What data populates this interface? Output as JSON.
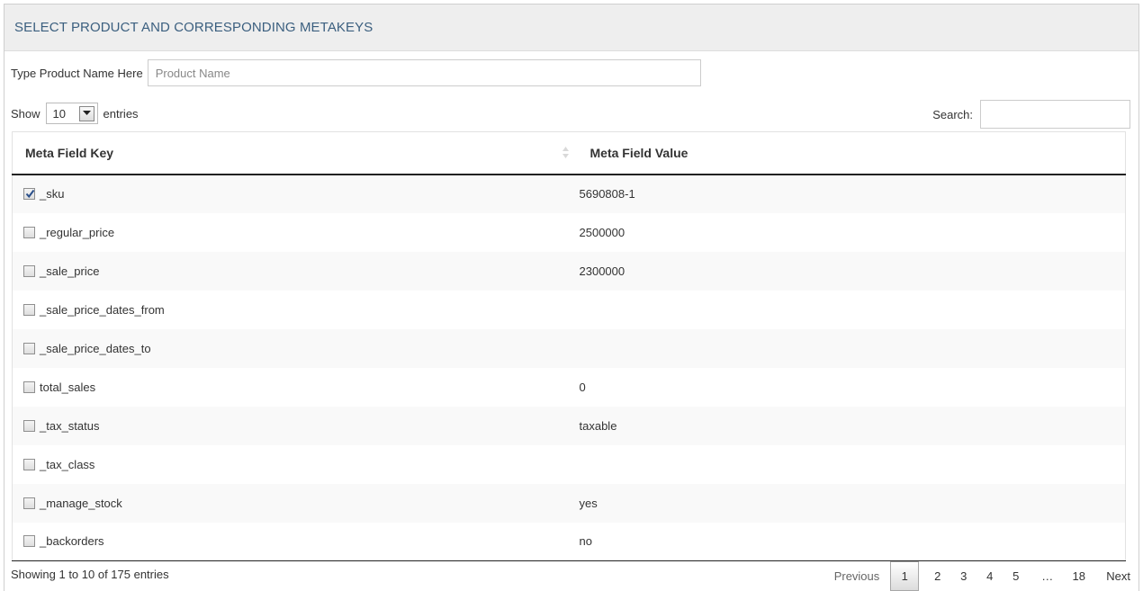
{
  "panel": {
    "title": "SELECT PRODUCT AND CORRESPONDING METAKEYS"
  },
  "product": {
    "label": "Type Product Name Here",
    "placeholder": "Product Name"
  },
  "length": {
    "show_label": "Show",
    "selected": "10",
    "entries_label": "entries"
  },
  "search": {
    "label": "Search:",
    "value": ""
  },
  "table": {
    "columns": [
      "Meta Field Key",
      "Meta Field Value"
    ],
    "rows": [
      {
        "key": "_sku",
        "value": "5690808-1",
        "checked": true
      },
      {
        "key": "_regular_price",
        "value": "2500000",
        "checked": false
      },
      {
        "key": "_sale_price",
        "value": "2300000",
        "checked": false
      },
      {
        "key": "_sale_price_dates_from",
        "value": "",
        "checked": false
      },
      {
        "key": "_sale_price_dates_to",
        "value": "",
        "checked": false
      },
      {
        "key": "total_sales",
        "value": "0",
        "checked": false
      },
      {
        "key": "_tax_status",
        "value": "taxable",
        "checked": false
      },
      {
        "key": "_tax_class",
        "value": "",
        "checked": false
      },
      {
        "key": "_manage_stock",
        "value": "yes",
        "checked": false
      },
      {
        "key": "_backorders",
        "value": "no",
        "checked": false
      }
    ]
  },
  "info": "Showing 1 to 10 of 175 entries",
  "pagination": {
    "previous": "Previous",
    "pages": [
      "1",
      "2",
      "3",
      "4",
      "5"
    ],
    "current": "1",
    "ellipsis": "…",
    "last": "18",
    "next": "Next"
  },
  "colors": {
    "title": "#3b5f7f",
    "heading_bg": "#eeeeee",
    "stripe": "#f9f9f9"
  }
}
